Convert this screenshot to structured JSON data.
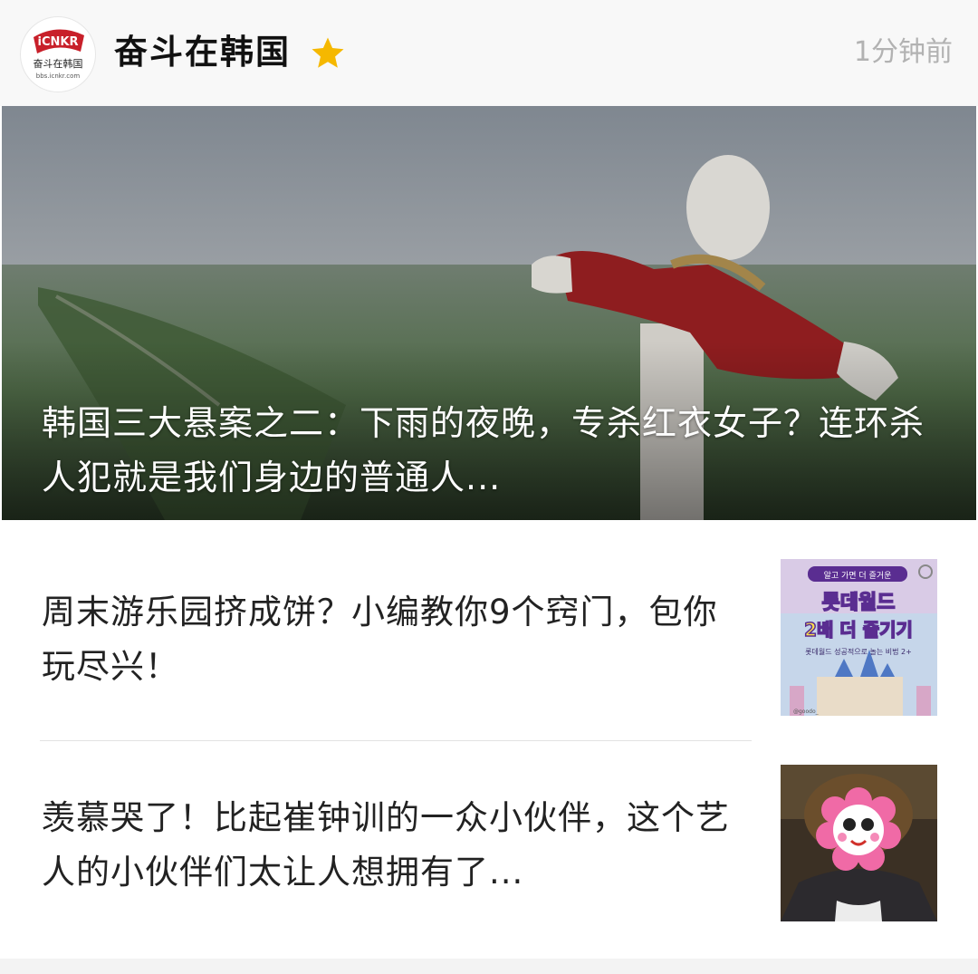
{
  "header": {
    "account_name": "奋斗在韩国",
    "time": "1分钟前",
    "avatar_logo_text": "iCNKR",
    "avatar_caption": "奋斗在韩国",
    "avatar_url_text": "bbs.icnkr.com",
    "star_color": "#f5b800"
  },
  "hero": {
    "title": "韩国三大悬案之二：下雨的夜晚，专杀红衣女子？连环杀人犯就是我们身边的普通人..."
  },
  "articles": [
    {
      "title": "周末游乐园挤成饼？小编教你9个窍门，包你玩尽兴！",
      "thumbnail": {
        "banner_text": "알고 가면 더 즐거운",
        "headline": "롯데월드",
        "subheadline": "2배 더 즐기기",
        "caption": "롯데월드 성공적으로 놀는 비법 2+",
        "credit": "@goodo_"
      }
    },
    {
      "title": "羡慕哭了！比起崔钟训的一众小伙伴，这个艺人的小伙伴们太让人想拥有了..."
    }
  ]
}
